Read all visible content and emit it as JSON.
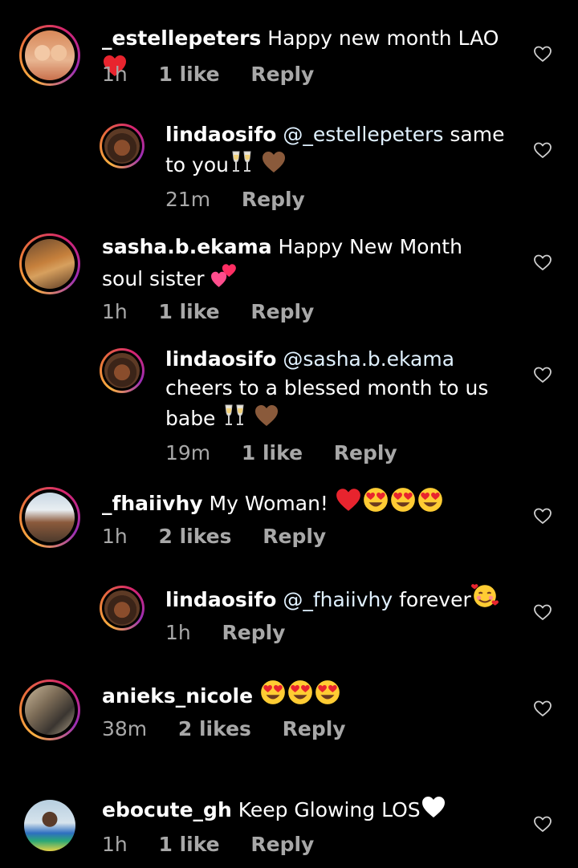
{
  "comments": [
    {
      "user": "_estellepeters",
      "text": "Happy new month LAO",
      "time": "1h",
      "likes": "1 like",
      "reply": "Reply"
    },
    {
      "user": "lindaosifo",
      "mention": "@_estellepeters",
      "text": "same to you",
      "time": "21m",
      "reply": "Reply"
    },
    {
      "user": "sasha.b.ekama",
      "text": "Happy New Month soul sister",
      "time": "1h",
      "likes": "1 like",
      "reply": "Reply"
    },
    {
      "user": "lindaosifo",
      "mention": "@sasha.b.ekama",
      "text": "cheers to a blessed month to us babe",
      "time": "19m",
      "likes": "1 like",
      "reply": "Reply"
    },
    {
      "user": "_fhaiivhy",
      "text": "My Woman!",
      "time": "1h",
      "likes": "2 likes",
      "reply": "Reply"
    },
    {
      "user": "lindaosifo",
      "mention": "@_fhaiivhy",
      "text": "forever",
      "time": "1h",
      "reply": "Reply"
    },
    {
      "user": "anieks_nicole",
      "text": "",
      "time": "38m",
      "likes": "2 likes",
      "reply": "Reply"
    },
    {
      "user": "ebocute_gh",
      "text": "Keep Glowing LOS",
      "time": "1h",
      "likes": "1 like",
      "reply": "Reply"
    }
  ],
  "icons": {
    "like": "heart-outline-icon",
    "avatar": "avatar"
  },
  "colors": {
    "background": "#000000",
    "meta": "#a8a8a8",
    "ring_start": "#f9b041",
    "ring_end": "#9b2eb5"
  }
}
